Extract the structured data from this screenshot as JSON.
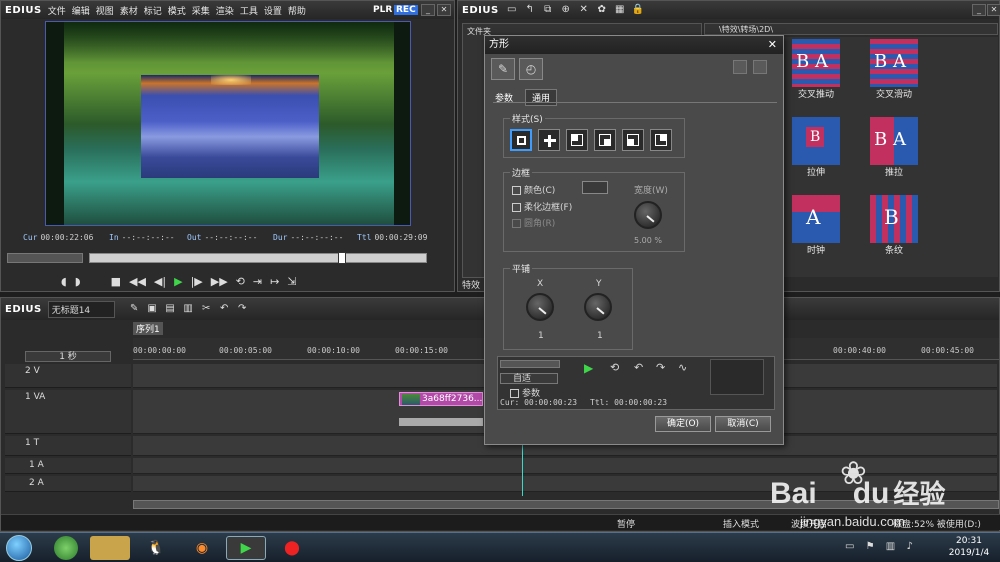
{
  "player": {
    "logo": "EDIUS",
    "menu": [
      "文件",
      "编辑",
      "视图",
      "素材",
      "标记",
      "模式",
      "采集",
      "渲染",
      "工具",
      "设置",
      "帮助"
    ],
    "plr": "PLR",
    "rec": "REC",
    "timecodes": {
      "cur_label": "Cur",
      "cur": "00:00:22:06",
      "in_label": "In",
      "in": "--:--:--:--",
      "out_label": "Out",
      "out": "--:--:--:--",
      "dur_label": "Dur",
      "dur": "--:--:--:--",
      "ttl_label": "Ttl",
      "ttl": "00:00:29:09"
    }
  },
  "bin": {
    "logo": "EDIUS",
    "folder_label": "文件夹",
    "path": "\\特效\\转场\\2D\\",
    "effects_tab": "特效",
    "thumbs": [
      {
        "label": "交叉推动",
        "letters": "B A"
      },
      {
        "label": "交叉滑动",
        "letters": "B A"
      },
      {
        "label": "拉伸",
        "letters": "B"
      },
      {
        "label": "推拉",
        "letters": "B A"
      },
      {
        "label": "时钟",
        "letters": "A"
      },
      {
        "label": "条纹",
        "letters": "B"
      }
    ]
  },
  "timeline": {
    "logo": "EDIUS",
    "project": "无标题14",
    "sequence_tab": "序列1",
    "scale": "1 秒",
    "ruler": [
      "00:00:00:00",
      "00:00:05:00",
      "00:00:10:00",
      "00:00:15:00",
      "00:00:40:00",
      "00:00:45:00"
    ],
    "tracks": [
      {
        "name": "2 V"
      },
      {
        "name": "1 VA"
      },
      {
        "name": "1 T"
      },
      {
        "name": "1 A"
      },
      {
        "name": "2 A"
      }
    ],
    "clip_name": "3a68ff2736..."
  },
  "dialog": {
    "title": "方形",
    "tabs": [
      "参数",
      "通用"
    ],
    "style_group": "样式(S)",
    "border_group": "边框",
    "color_label": "颜色(C)",
    "soft_label": "柔化边框(F)",
    "round_label": "圆角(R)",
    "width_label": "宽度(W)",
    "width_value": "5.00 %",
    "tile_group": "平铺",
    "x_label": "X",
    "y_label": "Y",
    "x_value": "1",
    "y_value": "1",
    "auto_label": "自适",
    "param_label": "参数",
    "cur_text": "Cur: 00:00:00:23",
    "ttl_text": "Ttl: 00:00:00:23",
    "ok": "确定(O)",
    "cancel": "取消(C)"
  },
  "status": {
    "pause": "暂停",
    "insert_mode": "插入模式",
    "ripple": "波纹开启",
    "disk": "磁盘:52% 被使用(D:)"
  },
  "watermark": {
    "brand": "Bai",
    "brand2": "du",
    "jingyan": "经验",
    "url": "jingyan.baidu.com"
  },
  "taskbar": {
    "time": "20:31",
    "date": "2019/1/4"
  },
  "colors": {
    "accent": "#3f9cff",
    "rec": "#2f6fe0",
    "play": "#3fd64a",
    "clip": "#b24aa8"
  }
}
